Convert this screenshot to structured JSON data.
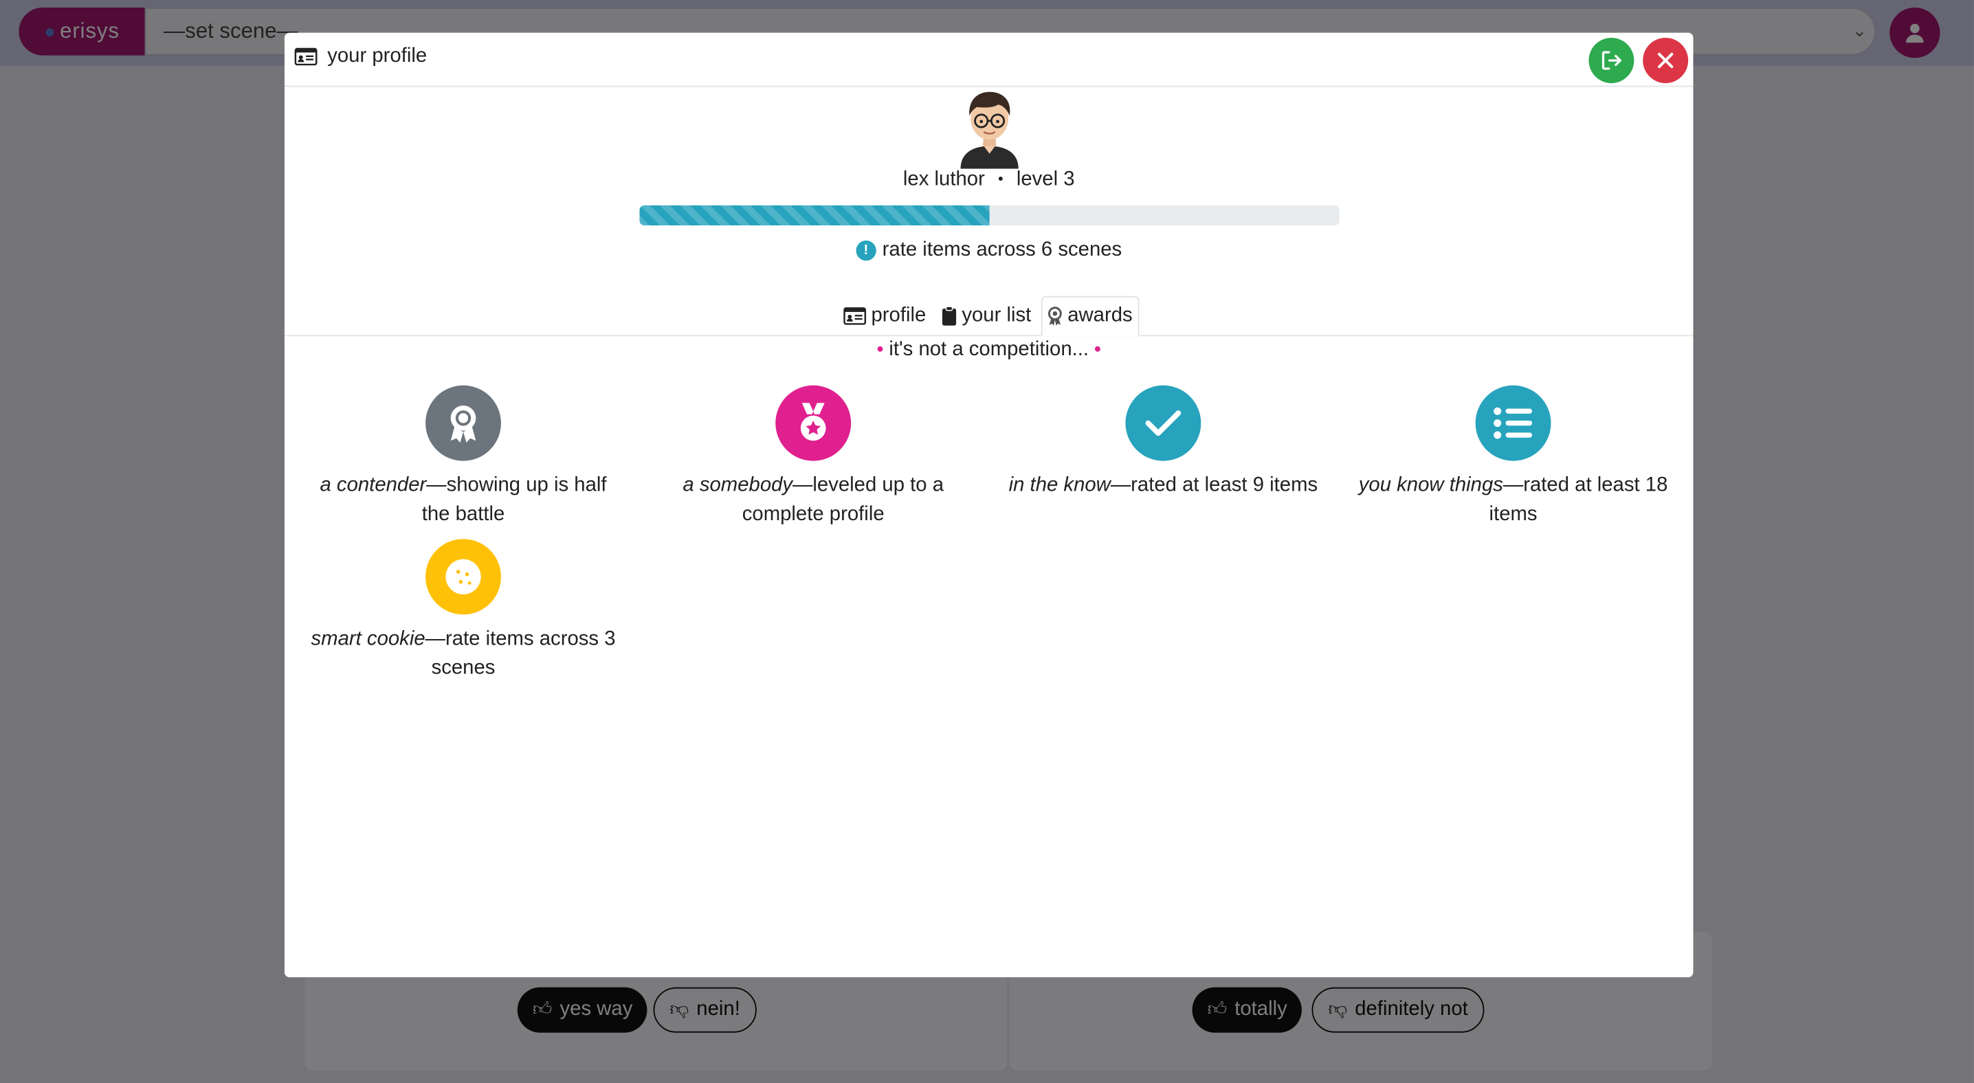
{
  "app": {
    "brand": "erisys",
    "scene_select": "—set scene—"
  },
  "background_cards": [
    {
      "up_label": "yes way",
      "down_label": "nein!"
    },
    {
      "up_label": "totally",
      "down_label": "definitely not"
    }
  ],
  "modal": {
    "title": "your profile",
    "logout_icon": "logout-icon",
    "close_icon": "close-icon"
  },
  "profile": {
    "name": "lex luthor",
    "separator": "•",
    "level": "level 3",
    "progress_percent": 50,
    "goal": "rate items across 6 scenes"
  },
  "tabs": [
    {
      "label": "profile",
      "icon": "id-card-icon",
      "active": false
    },
    {
      "label": "your list",
      "icon": "clipboard-icon",
      "active": false
    },
    {
      "label": "awards",
      "icon": "award-icon",
      "active": true
    }
  ],
  "tagline": "it's not a competition...",
  "awards": [
    {
      "name": "a contender",
      "desc": "—showing up is half the battle",
      "color": "#6c757d",
      "icon": "ribbon-award-icon"
    },
    {
      "name": "a somebody",
      "desc": "—leveled up to a complete profile",
      "color": "#e0208f",
      "icon": "medal-icon"
    },
    {
      "name": "in the know",
      "desc": "—rated at least 9 items",
      "color": "#27a3bd",
      "icon": "checkmark-icon"
    },
    {
      "name": "you know things",
      "desc": "—rated at least 18 items",
      "color": "#27a3bd",
      "icon": "list-icon"
    },
    {
      "name": "smart cookie",
      "desc": "—rate items across 3 scenes",
      "color": "#ffc107",
      "icon": "cookie-icon"
    }
  ]
}
